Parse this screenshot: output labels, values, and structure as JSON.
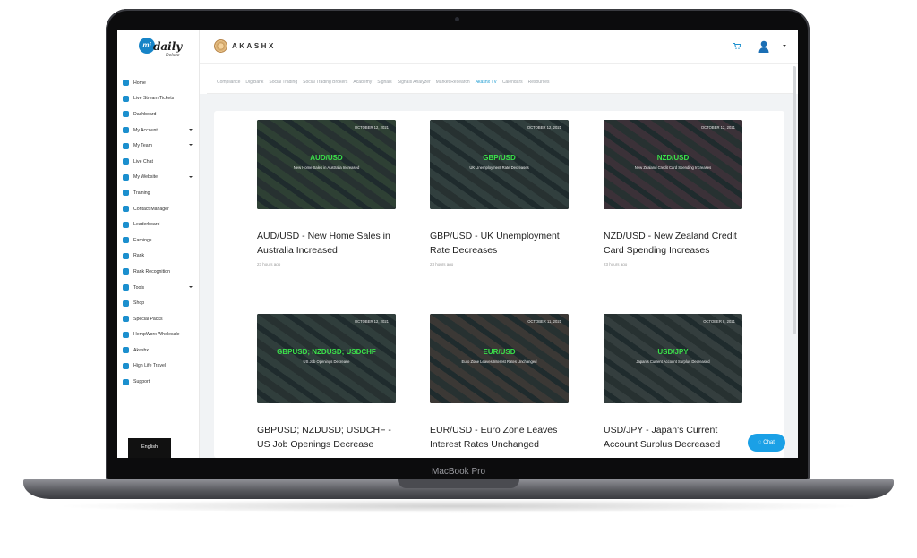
{
  "device": {
    "label": "MacBook Pro"
  },
  "brand": {
    "logo_prefix": "mi",
    "logo_text": "daily",
    "logo_sub": "Deluxe",
    "partner_name": "AKASHX"
  },
  "colors": {
    "accent": "#1b9bd1",
    "pair": "#3be24a",
    "chat": "#1aa0e6"
  },
  "sidebar": {
    "items": [
      {
        "label": "Home",
        "icon": "home-icon",
        "caret": false
      },
      {
        "label": "Live Stream Tickets",
        "icon": "ticket-icon",
        "caret": false
      },
      {
        "label": "Dashboard",
        "icon": "dashboard-icon",
        "caret": false
      },
      {
        "label": "My Account",
        "icon": "user-icon",
        "caret": true
      },
      {
        "label": "My Team",
        "icon": "team-icon",
        "caret": true
      },
      {
        "label": "Live Chat",
        "icon": "chat-icon",
        "caret": false
      },
      {
        "label": "My Website",
        "icon": "globe-icon",
        "caret": true
      },
      {
        "label": "Training",
        "icon": "training-icon",
        "caret": false
      },
      {
        "label": "Contact Manager",
        "icon": "contact-icon",
        "caret": false
      },
      {
        "label": "Leaderboard",
        "icon": "leaderboard-icon",
        "caret": false
      },
      {
        "label": "Earnings",
        "icon": "earnings-icon",
        "caret": false
      },
      {
        "label": "Rank",
        "icon": "trophy-icon",
        "caret": false
      },
      {
        "label": "Rank Recognition",
        "icon": "trophy-icon",
        "caret": false
      },
      {
        "label": "Tools",
        "icon": "tools-icon",
        "caret": true
      },
      {
        "label": "Shop",
        "icon": "shop-icon",
        "caret": false
      },
      {
        "label": "Special Packs",
        "icon": "pack-icon",
        "caret": false
      },
      {
        "label": "HempWorx Wholesale",
        "icon": "wholesale-icon",
        "caret": false
      },
      {
        "label": "Akashx",
        "icon": "akashx-icon",
        "caret": false
      },
      {
        "label": "High Life Travel",
        "icon": "plane-icon",
        "caret": false
      },
      {
        "label": "Support",
        "icon": "support-icon",
        "caret": false
      }
    ],
    "language": "English"
  },
  "tabs": [
    {
      "label": "Compliance",
      "active": false
    },
    {
      "label": "DigiBank",
      "active": false
    },
    {
      "label": "Social Trading",
      "active": false
    },
    {
      "label": "Social Trading Brokers",
      "active": false
    },
    {
      "label": "Academy",
      "active": false
    },
    {
      "label": "Signals",
      "active": false
    },
    {
      "label": "Signals Analyzer",
      "active": false
    },
    {
      "label": "Market Research",
      "active": false
    },
    {
      "label": "Akashx TV",
      "active": true
    },
    {
      "label": "Calendars",
      "active": false
    },
    {
      "label": "Resources",
      "active": false
    }
  ],
  "videos": [
    {
      "date": "OCTOBER 12, 2021",
      "pair": "AUD/USD",
      "subtitle": "New Home Sales in Australia Increased",
      "title": "AUD/USD - New Home Sales in Australia Increased",
      "ago": "23 hours ago",
      "tone": "#4f6b4a"
    },
    {
      "date": "OCTOBER 12, 2021",
      "pair": "GBP/USD",
      "subtitle": "UK Unemployment Rate Decreases",
      "title": "GBP/USD - UK Unemployment Rate Decreases",
      "ago": "23 hours ago",
      "tone": "#55685f"
    },
    {
      "date": "OCTOBER 12, 2021",
      "pair": "NZD/USD",
      "subtitle": "New Zealand Credit Card Spending Increases",
      "title": "NZD/USD - New Zealand Credit Card Spending Increases",
      "ago": "23 hours ago",
      "tone": "#6b4a52"
    },
    {
      "date": "OCTOBER 12, 2021",
      "pair": "GBPUSD; NZDUSD; USDCHF",
      "subtitle": "US Job Openings Decrease",
      "title": "GBPUSD; NZDUSD; USDCHF - US Job Openings Decrease",
      "ago": "",
      "tone": "#52665c"
    },
    {
      "date": "OCTOBER 11, 2021",
      "pair": "EUR/USD",
      "subtitle": "Euro Zone Leaves Interest Rates Unchanged",
      "title": "EUR/USD - Euro Zone Leaves Interest Rates Unchanged",
      "ago": "",
      "tone": "#6a5a4c"
    },
    {
      "date": "OCTOBER 8, 2021",
      "pair": "USD/JPY",
      "subtitle": "Japan's Current Account Surplus Decreased",
      "title": "USD/JPY - Japan's Current Account Surplus Decreased",
      "ago": "",
      "tone": "#5c6660"
    }
  ],
  "chat_label": "Chat"
}
